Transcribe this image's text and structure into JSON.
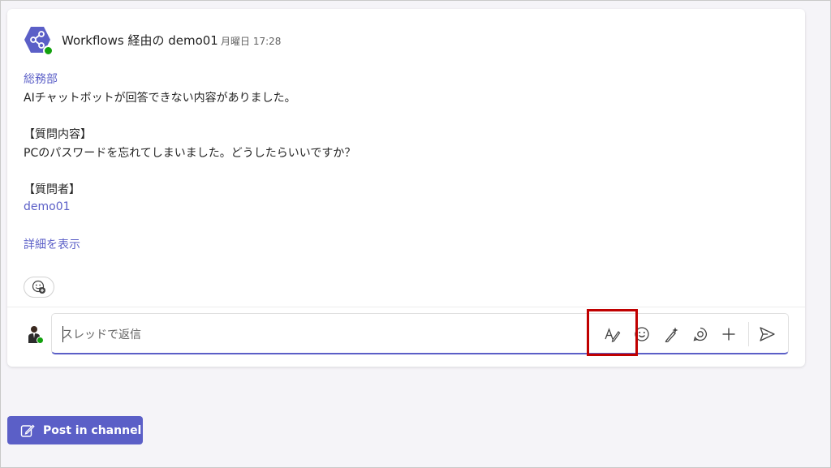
{
  "message": {
    "sender": "Workflows 経由の demo01",
    "timestamp": "月曜日 17:28",
    "lines": [
      "総務部",
      "AIチャットボットが回答できない内容がありました。",
      "【質問内容】",
      "PCのパスワードを忘れてしまいました。どうしたらいいですか？",
      "【質問者】",
      "demo01",
      "詳細を表示"
    ],
    "avatar_icon": "workflow-share-icon",
    "avatar_color": "#5b5fc7",
    "presence_color": "#13a10e"
  },
  "reaction": {
    "icon": "add-reaction-icon"
  },
  "reply": {
    "placeholder": "スレッドで返信",
    "value": "",
    "tools": [
      "format-icon",
      "emoji-icon",
      "copilot-icon",
      "loop-icon",
      "plus-icon",
      "send-icon"
    ]
  },
  "footer": {
    "post_label": "Post in channel",
    "post_icon": "compose-icon"
  },
  "colors": {
    "accent": "#5b5fc7",
    "highlight": "#c00000"
  }
}
